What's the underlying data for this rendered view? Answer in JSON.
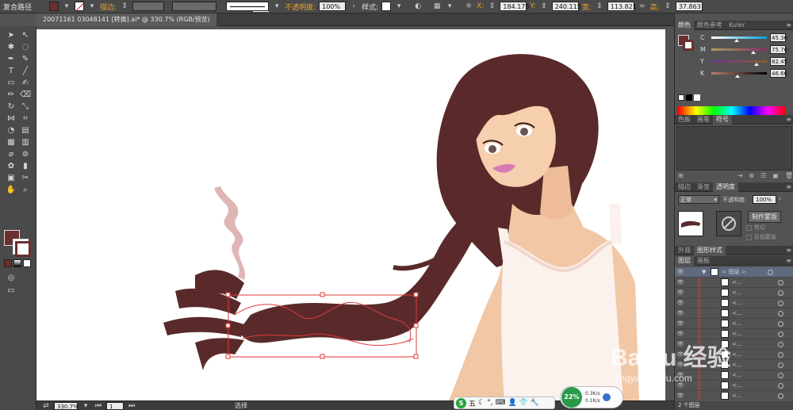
{
  "control_bar": {
    "path_type": "复合路径",
    "stroke_label": "描边:",
    "stroke_style": "基本",
    "opacity_label": "不透明度:",
    "opacity_value": "100%",
    "style_label": "样式:",
    "x_label": "X:",
    "x_value": "184.175",
    "y_label": "Y:",
    "y_value": "240.115",
    "w_label": "宽:",
    "w_value": "113.821",
    "h_label": "高:",
    "h_value": "37.863"
  },
  "document": {
    "tab_title": "20071161 03048141 [转换].ai* @ 330.7% (RGB/预览)"
  },
  "status_bar": {
    "zoom": "330.7%",
    "page": "1",
    "mode": "选择"
  },
  "panels": {
    "color_tabs": [
      "颜色",
      "颜色参考",
      "Kuler"
    ],
    "cmyk": [
      {
        "channel": "C",
        "value": "45.36",
        "level": 0.45
      },
      {
        "channel": "M",
        "value": "75.76",
        "level": 0.76
      },
      {
        "channel": "Y",
        "value": "82.45",
        "level": 0.82
      },
      {
        "channel": "K",
        "value": "46.66",
        "level": 0.47
      }
    ],
    "swatch_tabs": [
      "色板",
      "画笔",
      "符号"
    ],
    "transparency_tabs": [
      "描边",
      "渐变",
      "透明度"
    ],
    "blend_mode": "正常",
    "opacity_label": "不透明度:",
    "opacity_value": "100%",
    "make_mask_button": "制作蒙版",
    "clip_label": "剪切",
    "invert_mask_label": "反相蒙版",
    "appearance_tabs": [
      "外观",
      "图形样式"
    ],
    "layers_tabs": [
      "图层",
      "画板"
    ],
    "layer_name": "< 图层 >",
    "sublayer_label": "<...",
    "layers_footer": "2 个图层"
  },
  "taskbar": {
    "ime_label": "五",
    "cpu_percent": "22%",
    "up_rate": "0.3K/s",
    "down_rate": "0.1K/s"
  },
  "watermark": {
    "brand": "Baidu 经验",
    "url": "jingyan.baidu.com"
  },
  "colors": {
    "fill": "#6b2f2f",
    "hair": "#5a2a2a",
    "selection": "#e03a3a"
  }
}
